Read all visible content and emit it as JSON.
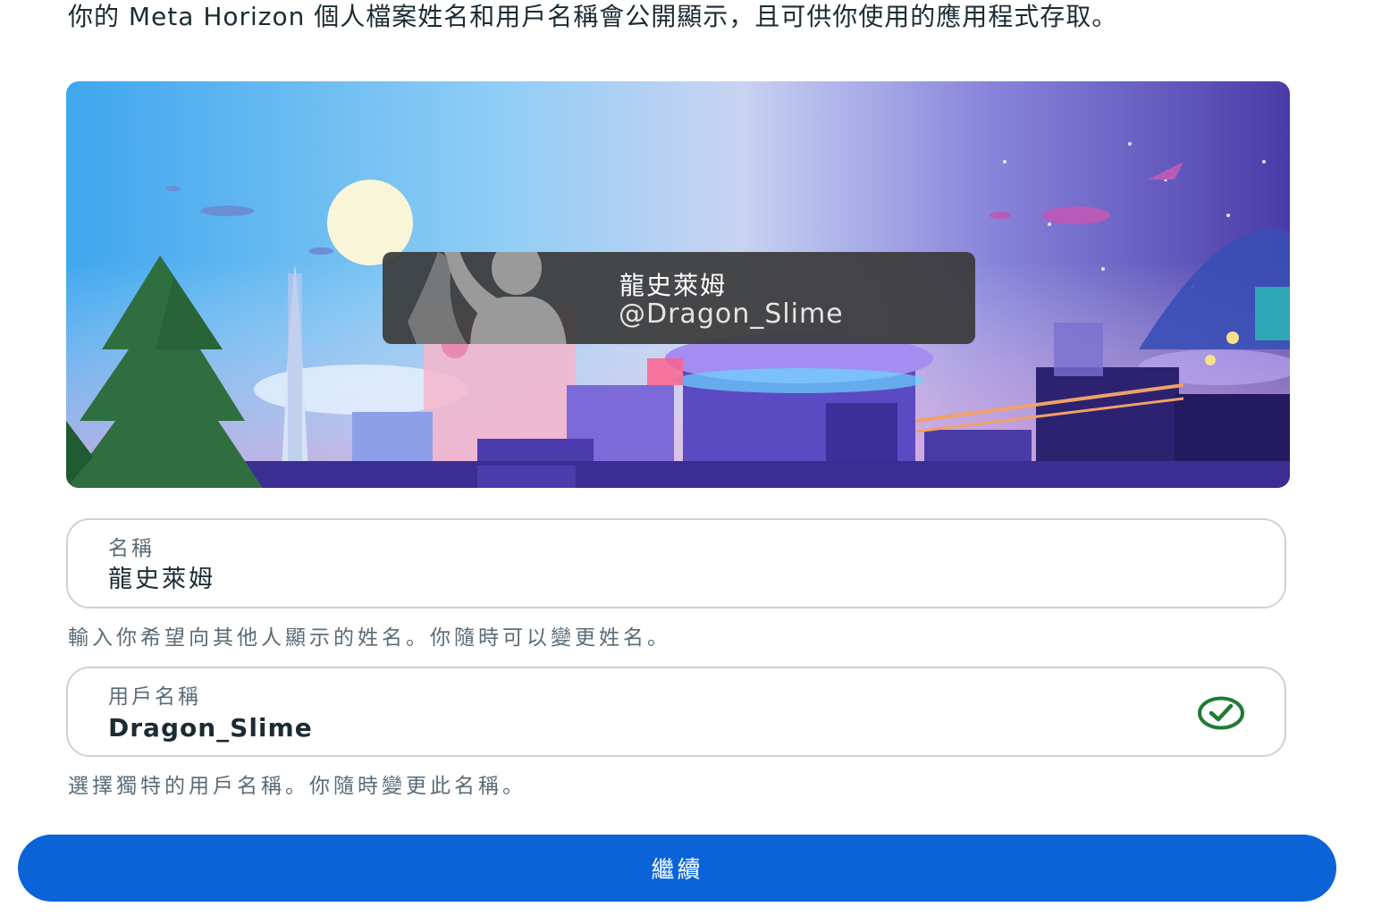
{
  "intro_text": "你的 Meta Horizon 個人檔案姓名和用戶名稱會公開顯示，且可供你使用的應用程式存取。",
  "preview_card": {
    "display_name": "龍史萊姆",
    "handle": "@Dragon_Slime",
    "avatar_icon": "avatar-silhouette-icon"
  },
  "name_field": {
    "label": "名稱",
    "value": "龍史萊姆",
    "helper": "輸入你希望向其他人顯示的姓名。你隨時可以變更姓名。"
  },
  "username_field": {
    "label": "用戶名稱",
    "value": "Dragon_Slime",
    "status_icon": "check-circle-icon",
    "status_color": "#1e7b34",
    "helper": "選擇獨特的用戶名稱。你隨時變更此名稱。"
  },
  "continue_button": {
    "label": "繼續",
    "color": "#0b63d8"
  }
}
